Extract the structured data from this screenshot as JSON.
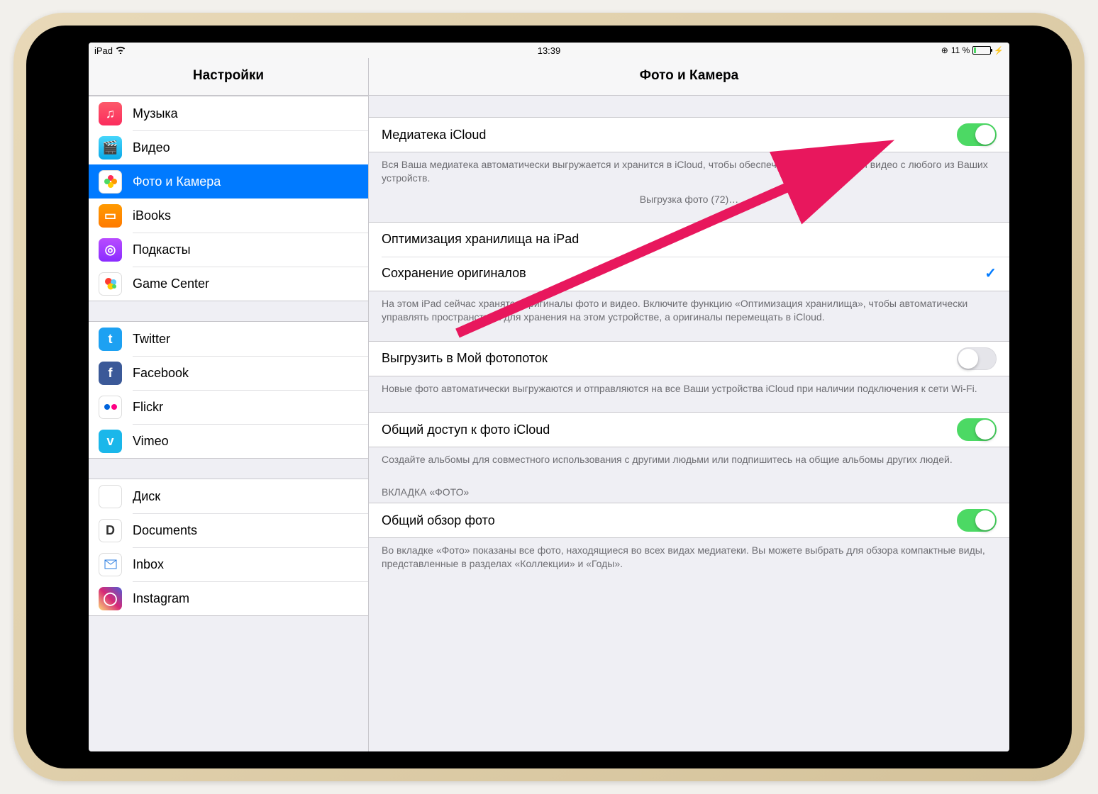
{
  "status": {
    "device": "iPad",
    "time": "13:39",
    "battery_text": "11 %"
  },
  "sidebar": {
    "title": "Настройки",
    "group1": [
      {
        "label": "Музыка",
        "icon": "music-icon"
      },
      {
        "label": "Видео",
        "icon": "video-icon"
      },
      {
        "label": "Фото и Камера",
        "icon": "photos-icon",
        "selected": true
      },
      {
        "label": "iBooks",
        "icon": "ibooks-icon"
      },
      {
        "label": "Подкасты",
        "icon": "podcasts-icon"
      },
      {
        "label": "Game Center",
        "icon": "gamecenter-icon"
      }
    ],
    "group2": [
      {
        "label": "Twitter",
        "icon": "twitter-icon"
      },
      {
        "label": "Facebook",
        "icon": "facebook-icon"
      },
      {
        "label": "Flickr",
        "icon": "flickr-icon"
      },
      {
        "label": "Vimeo",
        "icon": "vimeo-icon"
      }
    ],
    "group3": [
      {
        "label": "Диск",
        "icon": "disk-icon"
      },
      {
        "label": "Documents",
        "icon": "documents-icon"
      },
      {
        "label": "Inbox",
        "icon": "inbox-icon"
      },
      {
        "label": "Instagram",
        "icon": "instagram-icon"
      }
    ]
  },
  "detail": {
    "title": "Фото и Камера",
    "icloud_library": {
      "label": "Медиатека iCloud",
      "on": true,
      "footer": "Вся Ваша медиатека автоматически выгружается и хранится в iCloud, чтобы обеспечить доступ к фото и видео с любого из Ваших устройств.",
      "status": "Выгрузка фото (72)…"
    },
    "storage": {
      "optimize_label": "Оптимизация хранилища на iPad",
      "originals_label": "Сохранение оригиналов",
      "selected": "originals",
      "footer": "На этом iPad сейчас хранятся оригиналы фото и видео. Включите функцию «Оптимизация хранилища», чтобы автоматически управлять пространством для хранения на этом устройстве, а оригиналы перемещать в iCloud."
    },
    "photostream": {
      "label": "Выгрузить в Мой фотопоток",
      "on": false,
      "footer": "Новые фото автоматически выгружаются и отправляются на все Ваши устройства iCloud при наличии подключения к сети Wi-Fi."
    },
    "sharing": {
      "label": "Общий доступ к фото iCloud",
      "on": true,
      "footer": "Создайте альбомы для совместного использования с другими людьми или подпишитесь на общие альбомы других людей."
    },
    "tab_header": "ВКЛАДКА «ФОТО»",
    "summary": {
      "label": "Общий обзор фото",
      "on": true,
      "footer": "Во вкладке «Фото» показаны все фото, находящиеся во всех видах медиатеки. Вы можете выбрать для обзора компактные виды, представленные в разделах «Коллекции» и «Годы»."
    }
  },
  "colors": {
    "accent": "#007aff",
    "toggle_on": "#4cd964",
    "annotation": "#e8175d"
  }
}
